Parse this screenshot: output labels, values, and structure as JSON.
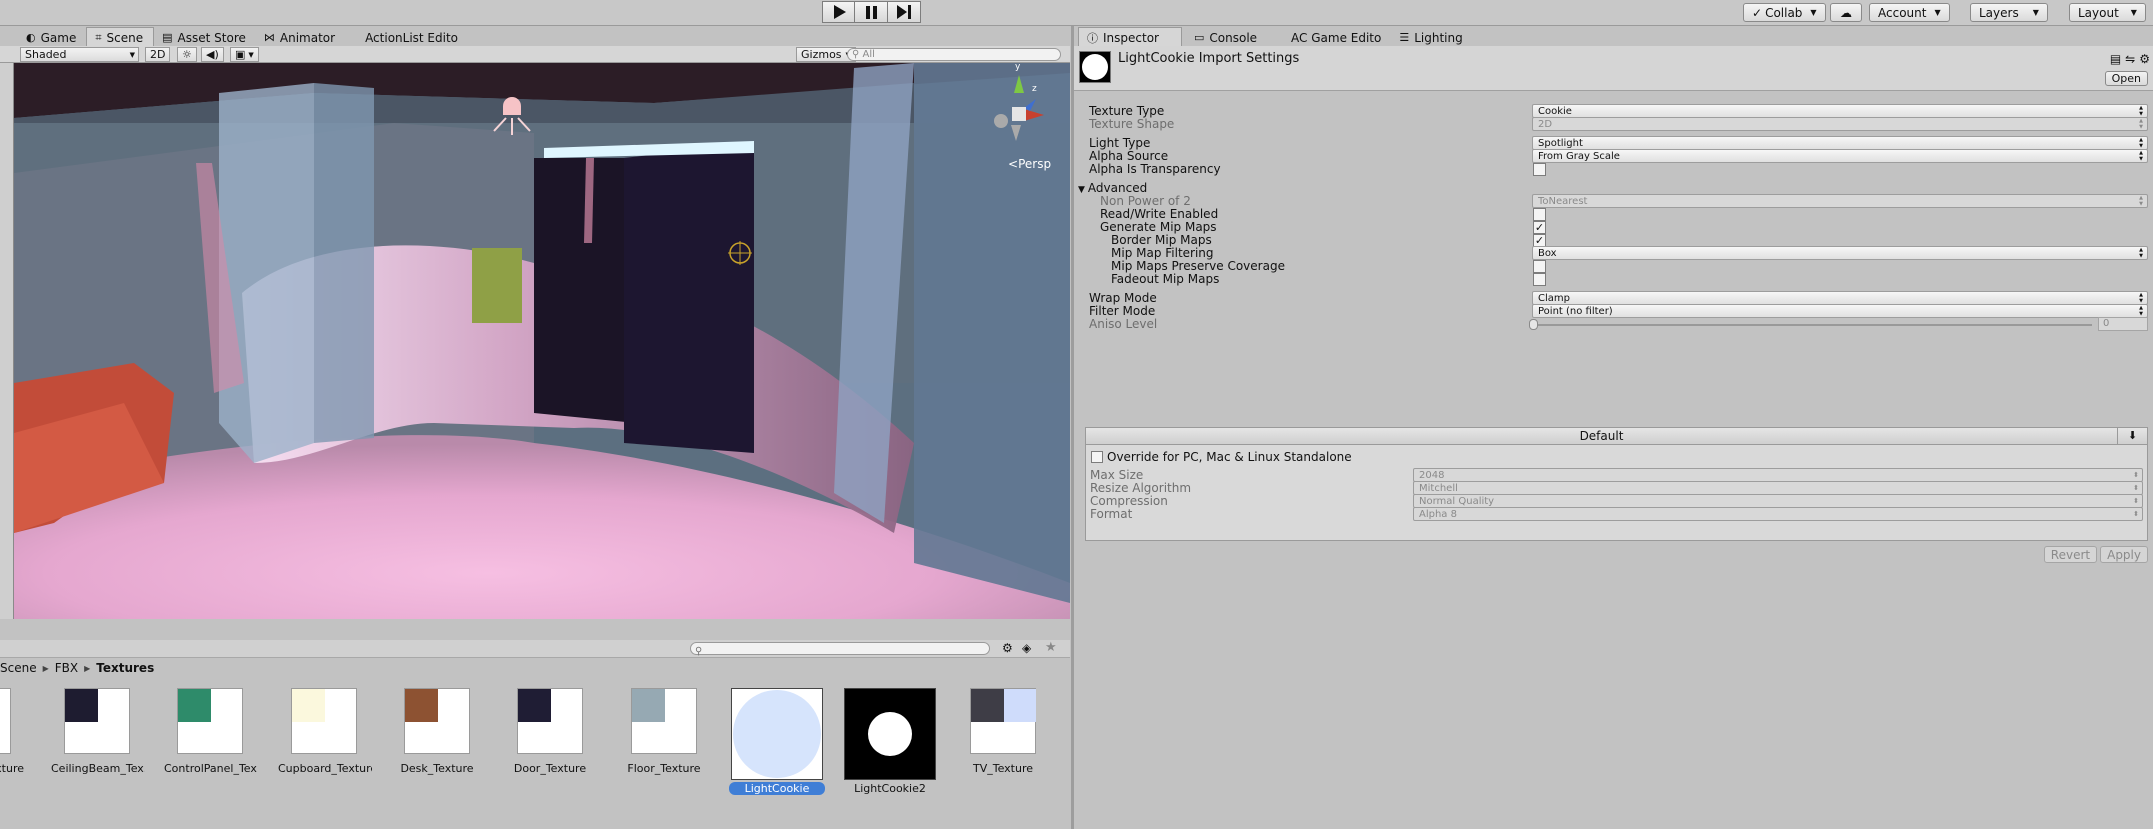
{
  "toolbar": {
    "collab": "Collab",
    "account": "Account",
    "layers": "Layers",
    "layout": "Layout"
  },
  "left_tabs": [
    {
      "label": "Game",
      "icon": "game-icon"
    },
    {
      "label": "Scene",
      "icon": "scene-icon"
    },
    {
      "label": "Asset Store",
      "icon": "asset-store-icon"
    },
    {
      "label": "Animator",
      "icon": "animator-icon"
    },
    {
      "label": "ActionList Edito",
      "icon": ""
    }
  ],
  "right_tabs": [
    {
      "label": "Inspector",
      "icon": "info-icon"
    },
    {
      "label": "Console",
      "icon": "console-icon"
    },
    {
      "label": "AC Game Edito",
      "icon": ""
    },
    {
      "label": "Lighting",
      "icon": "lighting-icon"
    }
  ],
  "scene_toolbar": {
    "shading": "Shaded",
    "mode_2d": "2D",
    "gizmos": "Gizmos",
    "search_placeholder": "All",
    "persp": "Persp"
  },
  "gizmo_axes": {
    "y": "y",
    "z": "z"
  },
  "project": {
    "breadcrumb": [
      "Scene",
      "FBX",
      "Textures"
    ],
    "assets": [
      {
        "label": "xture",
        "color": "#ffffff",
        "selected": false
      },
      {
        "label": "CeilingBeam_Tex...",
        "color": "#1e1c30",
        "selected": false
      },
      {
        "label": "ControlPanel_Tex...",
        "color": "#2e8b6a",
        "selected": false
      },
      {
        "label": "Cupboard_Texture",
        "color": "#fbf8dd",
        "selected": false
      },
      {
        "label": "Desk_Texture",
        "color": "#8d5232",
        "selected": false
      },
      {
        "label": "Door_Texture",
        "color": "#1f1d34",
        "selected": false
      },
      {
        "label": "Floor_Texture",
        "color": "#96a9b3",
        "selected": false
      },
      {
        "label": "LightCookie",
        "color": "#d6e4fc",
        "selected": true
      },
      {
        "label": "LightCookie2",
        "color": "#ffffff",
        "selected": false
      },
      {
        "label": "TV_Texture",
        "color": "#3e3d46",
        "selected": false
      }
    ]
  },
  "inspector": {
    "title": "LightCookie Import Settings",
    "open_button": "Open",
    "properties": [
      {
        "label": "Texture Type",
        "value": "Cookie",
        "kind": "dropdown",
        "indent": 0,
        "disabled": false
      },
      {
        "label": "Texture Shape",
        "value": "2D",
        "kind": "dropdown",
        "indent": 0,
        "disabled": true
      },
      {
        "label": "Light Type",
        "value": "Spotlight",
        "kind": "dropdown",
        "indent": 0,
        "disabled": false
      },
      {
        "label": "Alpha Source",
        "value": "From Gray Scale",
        "kind": "dropdown",
        "indent": 0,
        "disabled": false
      },
      {
        "label": "Alpha Is Transparency",
        "value": "",
        "kind": "checkbox",
        "checked": false,
        "indent": 0,
        "disabled": false
      },
      {
        "label": "Advanced",
        "value": "",
        "kind": "foldout",
        "indent": 0,
        "disabled": false
      },
      {
        "label": "Non Power of 2",
        "value": "ToNearest",
        "kind": "dropdown",
        "indent": 1,
        "disabled": true
      },
      {
        "label": "Read/Write Enabled",
        "value": "",
        "kind": "checkbox",
        "checked": false,
        "indent": 1,
        "disabled": false
      },
      {
        "label": "Generate Mip Maps",
        "value": "",
        "kind": "checkbox",
        "checked": true,
        "indent": 1,
        "disabled": false
      },
      {
        "label": "Border Mip Maps",
        "value": "",
        "kind": "checkbox",
        "checked": true,
        "indent": 2,
        "disabled": false
      },
      {
        "label": "Mip Map Filtering",
        "value": "Box",
        "kind": "dropdown",
        "indent": 2,
        "disabled": false
      },
      {
        "label": "Mip Maps Preserve Coverage",
        "value": "",
        "kind": "checkbox",
        "checked": false,
        "indent": 2,
        "disabled": false
      },
      {
        "label": "Fadeout Mip Maps",
        "value": "",
        "kind": "checkbox",
        "checked": false,
        "indent": 2,
        "disabled": false
      },
      {
        "label": "Wrap Mode",
        "value": "Clamp",
        "kind": "dropdown",
        "indent": 0,
        "disabled": false
      },
      {
        "label": "Filter Mode",
        "value": "Point (no filter)",
        "kind": "dropdown",
        "indent": 0,
        "disabled": false
      },
      {
        "label": "Aniso Level",
        "value": "0",
        "kind": "slider",
        "indent": 0,
        "disabled": true
      }
    ],
    "platform": {
      "tab": "Default",
      "override_label": "Override for PC, Mac & Linux Standalone",
      "rows": [
        {
          "label": "Max Size",
          "value": "2048"
        },
        {
          "label": "Resize Algorithm",
          "value": "Mitchell"
        },
        {
          "label": "Compression",
          "value": "Normal Quality"
        },
        {
          "label": "Format",
          "value": "Alpha 8"
        }
      ]
    },
    "revert": "Revert",
    "apply": "Apply"
  }
}
